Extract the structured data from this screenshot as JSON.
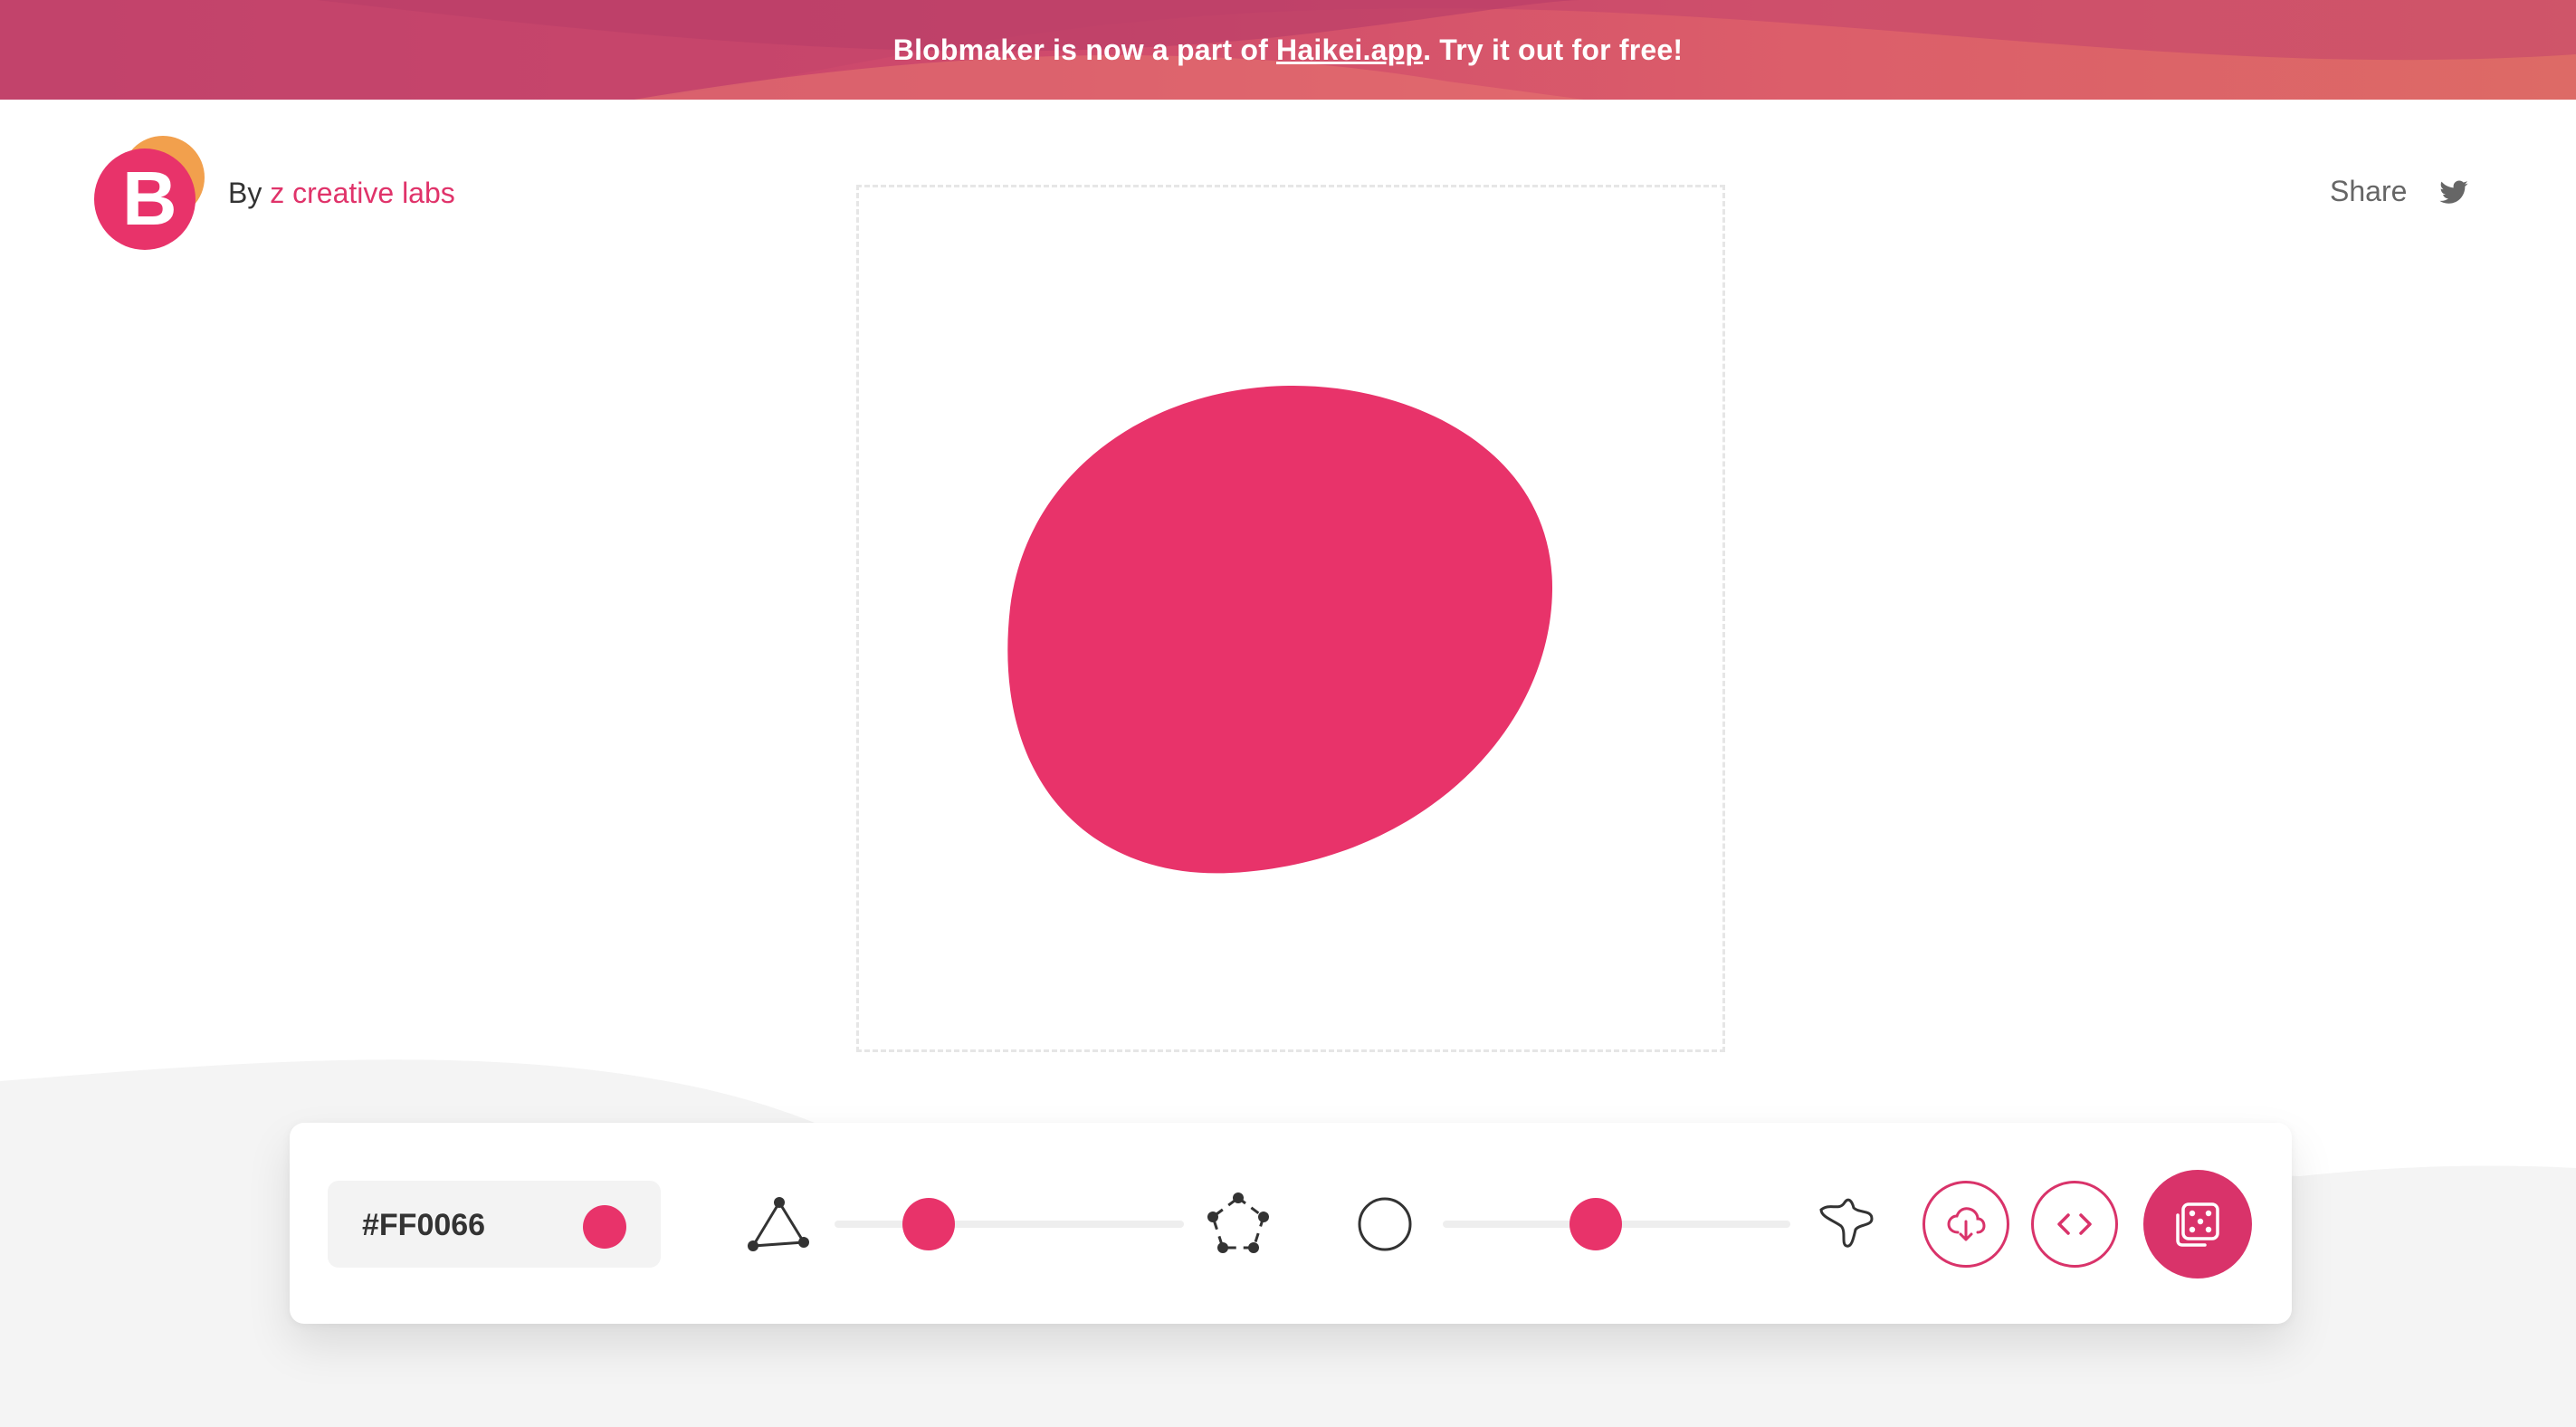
{
  "banner": {
    "text_before": "Blobmaker is now a part of ",
    "link": "Haikei.app",
    "text_after": ". Try it out for free!"
  },
  "header": {
    "logo_letter": "B",
    "by_label": "By",
    "brand": "z creative labs",
    "share_label": "Share"
  },
  "toolbar": {
    "color_value": "#FF0066",
    "complexity_level": 0.23,
    "contrast_level": 0.43
  },
  "colors": {
    "accent": "#e8336a",
    "banner_start": "#c1436a",
    "banner_end": "#dd6a66"
  },
  "icons": {
    "logo": "blobmaker-logo",
    "share": "twitter-icon",
    "complexity_min": "triangle-nodes-icon",
    "complexity_max": "pentagon-nodes-icon",
    "contrast_min": "circle-outline-icon",
    "contrast_max": "spiky-blob-icon",
    "download": "cloud-download-icon",
    "code": "code-brackets-icon",
    "randomize": "dice-icon"
  }
}
